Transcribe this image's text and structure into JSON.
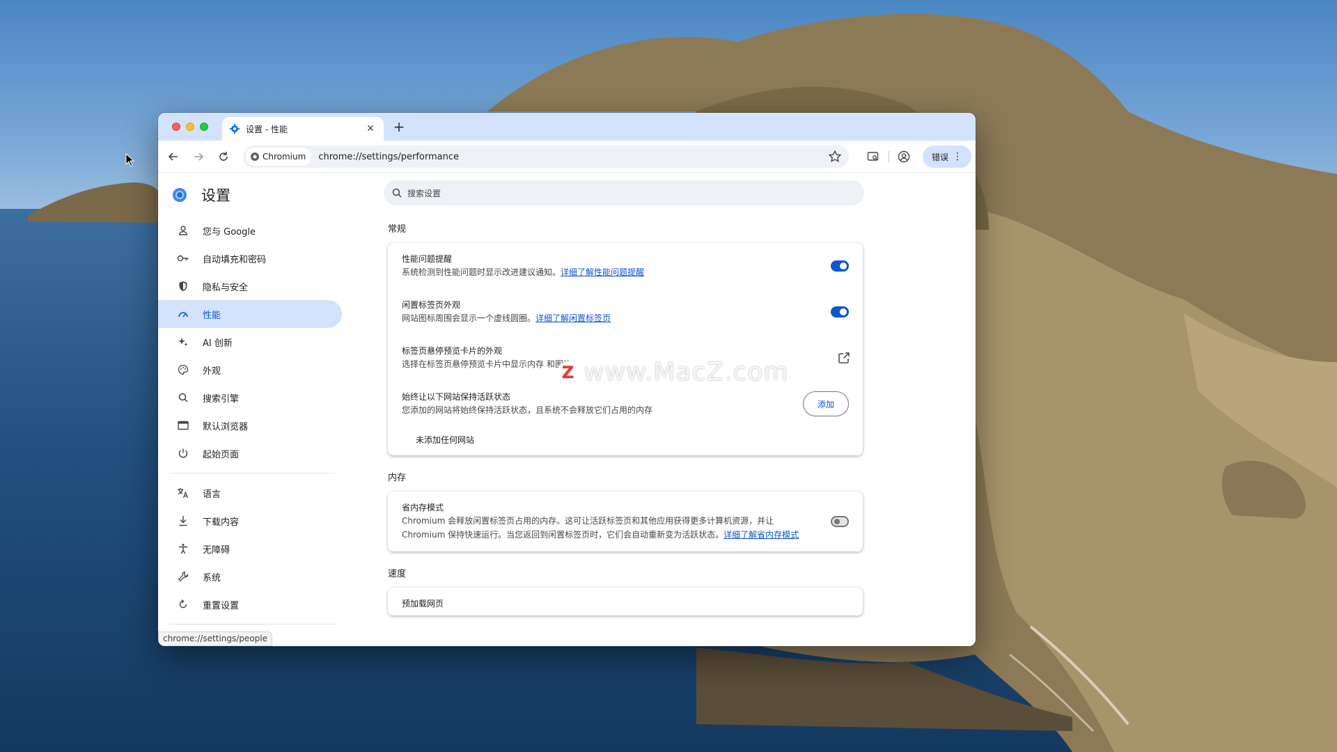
{
  "browser": {
    "tab": {
      "title": "设置 - 性能"
    },
    "toolbar": {
      "chip_label": "Chromium",
      "url": "chrome://settings/performance",
      "error_label": "错误"
    }
  },
  "settings": {
    "title": "设置",
    "search_placeholder": "搜索设置",
    "nav": [
      {
        "label": "您与 Google",
        "icon": "person-icon"
      },
      {
        "label": "自动填充和密码",
        "icon": "key-icon"
      },
      {
        "label": "隐私与安全",
        "icon": "shield-icon"
      },
      {
        "label": "性能",
        "icon": "speedometer-icon",
        "active": true
      },
      {
        "label": "AI 创新",
        "icon": "sparkle-icon"
      },
      {
        "label": "外观",
        "icon": "palette-icon"
      },
      {
        "label": "搜索引擎",
        "icon": "search-icon"
      },
      {
        "label": "默认浏览器",
        "icon": "browser-window-icon"
      },
      {
        "label": "起始页面",
        "icon": "power-icon"
      },
      {
        "label": "语言",
        "icon": "translate-icon"
      },
      {
        "label": "下载内容",
        "icon": "download-icon"
      },
      {
        "label": "无障碍",
        "icon": "accessibility-icon"
      },
      {
        "label": "系统",
        "icon": "wrench-icon"
      },
      {
        "label": "重置设置",
        "icon": "reset-icon"
      }
    ],
    "status_url": "chrome://settings/people",
    "sections": {
      "general": {
        "title": "常规",
        "perf_alert": {
          "title": "性能问题提醒",
          "desc": "系统检测到性能问题时显示改进建议通知。",
          "link": "详细了解性能问题提醒",
          "enabled": true
        },
        "inactive_tab": {
          "title": "闲置标签页外观",
          "desc": "网站图标周围会显示一个虚线圆圈。",
          "link": "详细了解闲置标签页",
          "enabled": true
        },
        "hover_card": {
          "title": "标签页悬停预览卡片的外观",
          "desc": "选择在标签页悬停预览卡片中显示内存 和图片"
        },
        "keep_active": {
          "title": "始终让以下网站保持活跃状态",
          "desc": "您添加的网站将始终保持活跃状态，且系统不会释放它们占用的内存",
          "add_label": "添加",
          "empty_note": "未添加任何网站"
        }
      },
      "memory": {
        "title": "内存",
        "saver": {
          "title": "省内存模式",
          "desc": "Chromium 会释放闲置标签页占用的内存。这可让活跃标签页和其他应用获得更多计算机资源，并让 Chromium 保持快速运行。当您返回到闲置标签页时，它们会自动重新变为活跃状态。",
          "link": "详细了解省内存模式",
          "enabled": false
        }
      },
      "speed": {
        "title": "速度",
        "preload_title": "预加载网页"
      }
    }
  },
  "watermark": {
    "badge": "Z",
    "text": "www.MacZ.com"
  }
}
